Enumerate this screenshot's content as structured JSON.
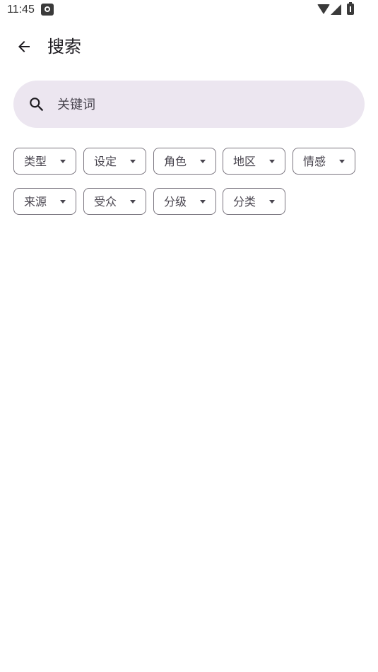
{
  "status_bar": {
    "time": "11:45",
    "icons": [
      "app-notification-icon",
      "wifi-icon",
      "cell-signal-icon",
      "battery-charging-icon"
    ]
  },
  "top_bar": {
    "back_icon": "arrow-back-icon",
    "title": "搜索"
  },
  "search": {
    "icon": "search-icon",
    "value": "",
    "placeholder": "关键词",
    "background": "#ece6f0"
  },
  "filters": {
    "row1": [
      {
        "label": "类型"
      },
      {
        "label": "设定"
      },
      {
        "label": "角色"
      },
      {
        "label": "地区"
      },
      {
        "label": "情感"
      }
    ],
    "row2": [
      {
        "label": "来源"
      },
      {
        "label": "受众"
      },
      {
        "label": "分级"
      },
      {
        "label": "分类"
      }
    ],
    "dropdown_icon": "arrow-drop-down-icon",
    "border_color": "#79747e"
  }
}
